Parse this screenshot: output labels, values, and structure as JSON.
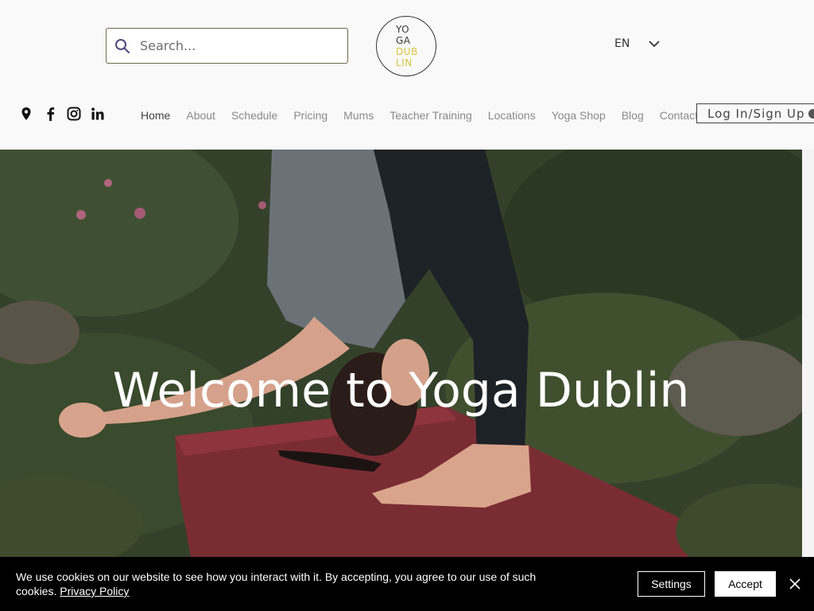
{
  "search": {
    "placeholder": "Search..."
  },
  "logo": {
    "line1": "YO",
    "line2": "GA",
    "line3": "DUB",
    "line4": "LIN"
  },
  "language": {
    "current": "EN"
  },
  "socials": [
    {
      "icon": "location-pin-icon"
    },
    {
      "icon": "facebook-icon"
    },
    {
      "icon": "instagram-icon"
    },
    {
      "icon": "linkedin-icon"
    }
  ],
  "nav": {
    "items": [
      {
        "label": "Home",
        "active": true
      },
      {
        "label": "About"
      },
      {
        "label": "Schedule"
      },
      {
        "label": "Pricing"
      },
      {
        "label": "Mums"
      },
      {
        "label": "Teacher Training"
      },
      {
        "label": "Locations"
      },
      {
        "label": "Yoga Shop"
      },
      {
        "label": "Blog"
      },
      {
        "label": "Contact"
      }
    ]
  },
  "login": {
    "label": "Log In/Sign Up"
  },
  "hero": {
    "title": "Welcome to Yoga Dublin"
  },
  "cookie_bar": {
    "message": "We use cookies on our website to see how you interact with it. By accepting, you agree to our use of such cookies.",
    "policy_link": "Privacy Policy",
    "settings_label": "Settings",
    "accept_label": "Accept"
  },
  "colors": {
    "logo_accent": "#d6c341",
    "cookie_bar_bg": "#000000",
    "nav_text": "#8a8a8a"
  }
}
